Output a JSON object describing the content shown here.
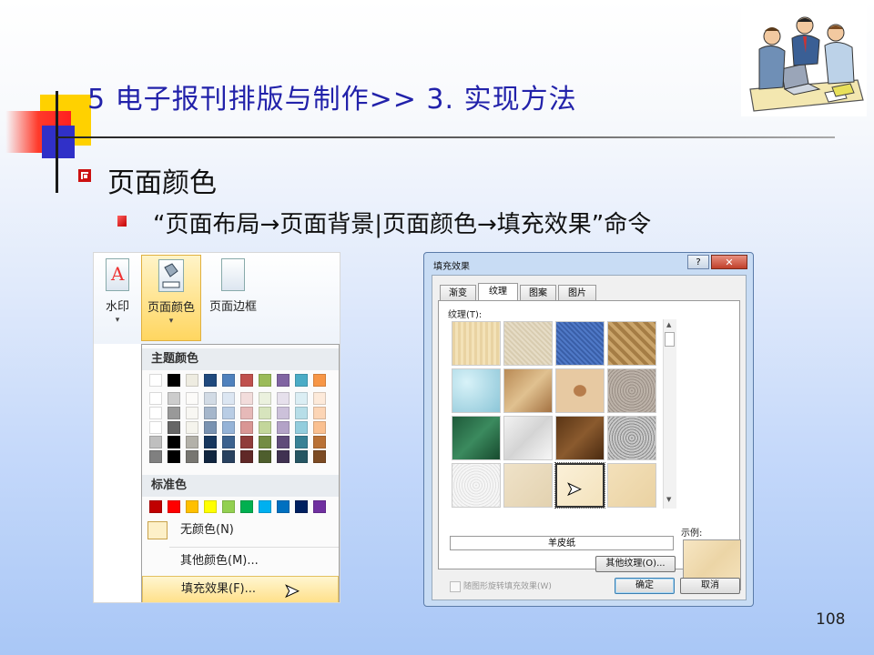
{
  "slide": {
    "title": "5 电子报刊排版与制作>> 3. 实现方法",
    "bullet1": "页面颜色",
    "bullet2": "“页面布局→页面背景|页面颜色→填充效果”命令",
    "page_number": "108",
    "colors": {
      "title": "#2222aa",
      "bullet": "#cc1111",
      "accent_yellow": "#ffd100",
      "accent_blue": "#3030c8"
    }
  },
  "ribbon": {
    "buttons": [
      {
        "label": "水印",
        "icon": "watermark-icon"
      },
      {
        "label": "页面颜色",
        "icon": "page-color-icon"
      },
      {
        "label": "页面边框",
        "icon": "page-border-icon"
      }
    ],
    "dropdown_arrow": "▾",
    "menu": {
      "theme_colors_header": "主题颜色",
      "standard_colors_header": "标准色",
      "theme_top_row": [
        "#ffffff",
        "#000000",
        "#eeece1",
        "#1f497d",
        "#4f81bd",
        "#c0504d",
        "#9bbb59",
        "#8064a2",
        "#4bacc6",
        "#f79646"
      ],
      "standard_row": [
        "#c00000",
        "#ff0000",
        "#ffc000",
        "#ffff00",
        "#92d050",
        "#00b050",
        "#00b0f0",
        "#0070c0",
        "#002060",
        "#7030a0"
      ],
      "no_color": "无颜色(N)",
      "more_colors": "其他颜色(M)...",
      "fill_effects": "填充效果(F)..."
    }
  },
  "dialog": {
    "title": "填充效果",
    "help": "?",
    "close": "✕",
    "tabs": [
      "渐变",
      "纹理",
      "图案",
      "图片"
    ],
    "selected_tab": "纹理",
    "texture_label": "纹理(T):",
    "selected_texture_name": "羊皮纸",
    "other_textures_button": "其他纹理(O)...",
    "rotate_checkbox": "随图形旋转填充效果(W)",
    "sample_label": "示例:",
    "ok": "确定",
    "cancel": "取消",
    "textures": [
      "papyrus",
      "canvas",
      "denim",
      "woven-mat",
      "water-droplets",
      "paper-bag",
      "fish-fossil",
      "sand",
      "green-marble",
      "white-marble",
      "brown-marble",
      "granite",
      "newsprint",
      "recycled-paper",
      "parchment",
      "stationery"
    ]
  }
}
